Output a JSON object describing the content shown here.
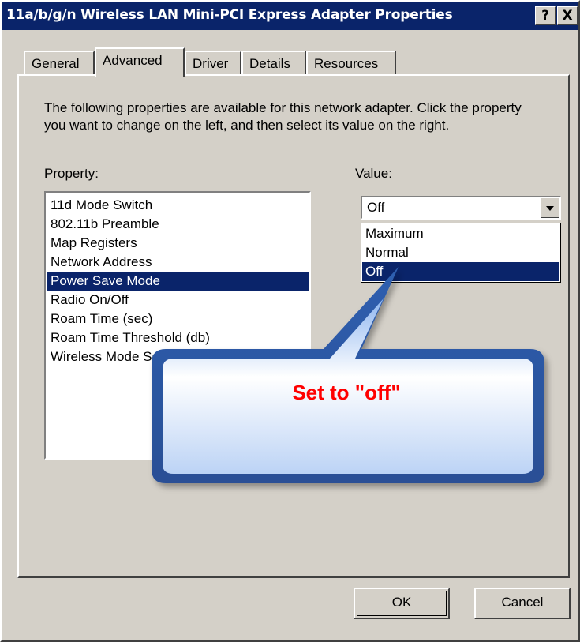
{
  "window": {
    "title": "11a/b/g/n Wireless LAN Mini-PCI Express Adapter Properties",
    "help_label": "?",
    "close_label": "X"
  },
  "tabs": [
    {
      "label": "General"
    },
    {
      "label": "Advanced"
    },
    {
      "label": "Driver"
    },
    {
      "label": "Details"
    },
    {
      "label": "Resources"
    }
  ],
  "advanced": {
    "description": "The following properties are available for this network adapter. Click the property you want to change on the left, and then select its value on the right.",
    "property_label": "Property:",
    "value_label": "Value:",
    "properties": [
      {
        "label": "11d Mode Switch"
      },
      {
        "label": "802.11b Preamble"
      },
      {
        "label": "Map Registers"
      },
      {
        "label": "Network Address"
      },
      {
        "label": "Power Save Mode"
      },
      {
        "label": "Radio On/Off"
      },
      {
        "label": "Roam Time (sec)"
      },
      {
        "label": "Roam Time Threshold (db)"
      },
      {
        "label": "Wireless Mode Settings"
      }
    ],
    "selected_property": "Power Save Mode",
    "value_selected": "Off",
    "value_options": [
      {
        "label": "Maximum"
      },
      {
        "label": "Normal"
      },
      {
        "label": "Off"
      }
    ]
  },
  "callout": {
    "text": "Set to \"off\"",
    "text_color": "#ff0000",
    "fill_color": "#4a7fd6"
  },
  "buttons": {
    "ok_label": "OK",
    "cancel_label": "Cancel"
  },
  "colors": {
    "titlebar": "#0a246a",
    "dialog_face": "#d4d0c8",
    "selection": "#0a246a"
  }
}
